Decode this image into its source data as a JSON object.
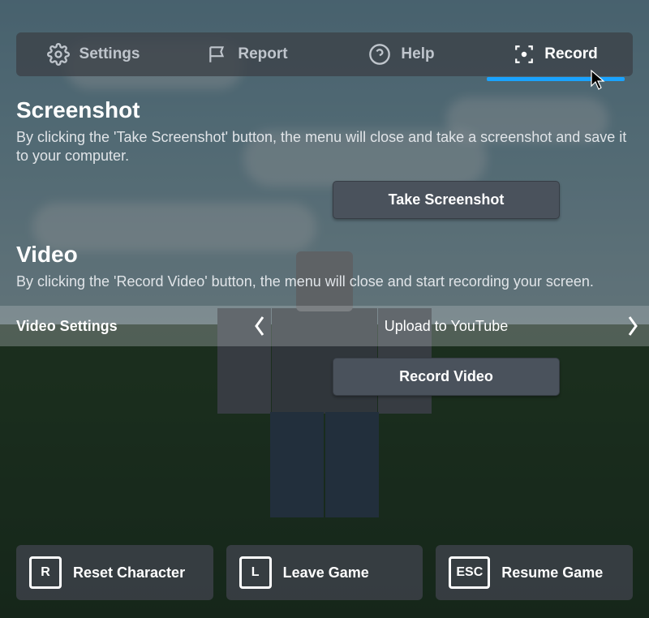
{
  "tabs": {
    "settings": "Settings",
    "report": "Report",
    "help": "Help",
    "record": "Record"
  },
  "screenshot": {
    "title": "Screenshot",
    "desc": "By clicking the 'Take Screenshot' button, the menu will close and take a screenshot and save it to your computer.",
    "button": "Take Screenshot"
  },
  "video": {
    "title": "Video",
    "desc": "By clicking the 'Record Video' button, the menu will close and start recording your screen.",
    "settings_label": "Video Settings",
    "settings_value": "Upload to YouTube",
    "button": "Record Video"
  },
  "bottom": {
    "reset": {
      "key": "R",
      "label": "Reset Character"
    },
    "leave": {
      "key": "L",
      "label": "Leave Game"
    },
    "resume": {
      "key": "ESC",
      "label": "Resume Game"
    }
  }
}
